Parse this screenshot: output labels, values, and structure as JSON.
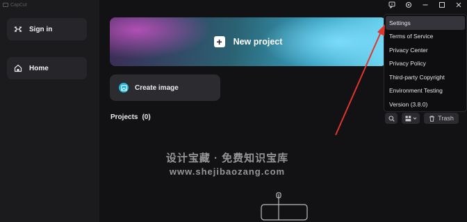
{
  "app": {
    "title": "CapCut"
  },
  "sidebar": {
    "sign_in": "Sign in",
    "home": "Home"
  },
  "main": {
    "new_project": "New project",
    "create_image": "Create image",
    "projects_label": "Projects",
    "projects_count": "(0)",
    "trash": "Trash"
  },
  "menu": {
    "items": [
      "Settings",
      "Terms of Service",
      "Privacy Center",
      "Privacy Policy",
      "Third-party Copyright",
      "Environment Testing",
      "Version (3.8.0)"
    ]
  },
  "watermark": {
    "line1": "设计宝藏 · 免费知识宝库",
    "line2": "www.shejibaozang.com"
  },
  "icons": {
    "feedback": "feedback-icon",
    "settings": "gear-icon",
    "minimize": "minimize-icon",
    "maximize": "maximize-icon",
    "close": "close-icon"
  },
  "colors": {
    "accent_cyan": "#25b4dc",
    "arrow_red": "#e0352b"
  }
}
